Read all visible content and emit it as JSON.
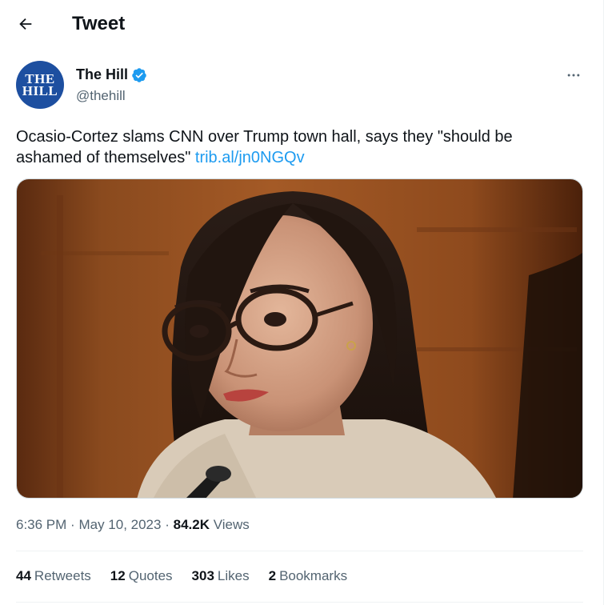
{
  "header": {
    "title": "Tweet"
  },
  "author": {
    "avatar_line1": "THE",
    "avatar_line2": "HILL",
    "name": "The Hill",
    "handle": "@thehill",
    "verified_color": "#1d9bf0",
    "avatar_color": "#1d4fa0"
  },
  "tweet": {
    "text": "Ocasio-Cortez slams CNN over Trump town hall, says they \"should be ashamed of themselves\"",
    "link": "trib.al/jn0NGQv"
  },
  "meta": {
    "time": "6:36 PM",
    "separator": "·",
    "date": "May 10, 2023",
    "views_count": "84.2K",
    "views_label": "Views"
  },
  "stats": {
    "retweets_count": "44",
    "retweets_label": "Retweets",
    "quotes_count": "12",
    "quotes_label": "Quotes",
    "likes_count": "303",
    "likes_label": "Likes",
    "bookmarks_count": "2",
    "bookmarks_label": "Bookmarks"
  },
  "icons": {
    "back": "arrow-left-icon",
    "verified": "verified-badge-icon",
    "more": "more-horizontal-icon"
  }
}
